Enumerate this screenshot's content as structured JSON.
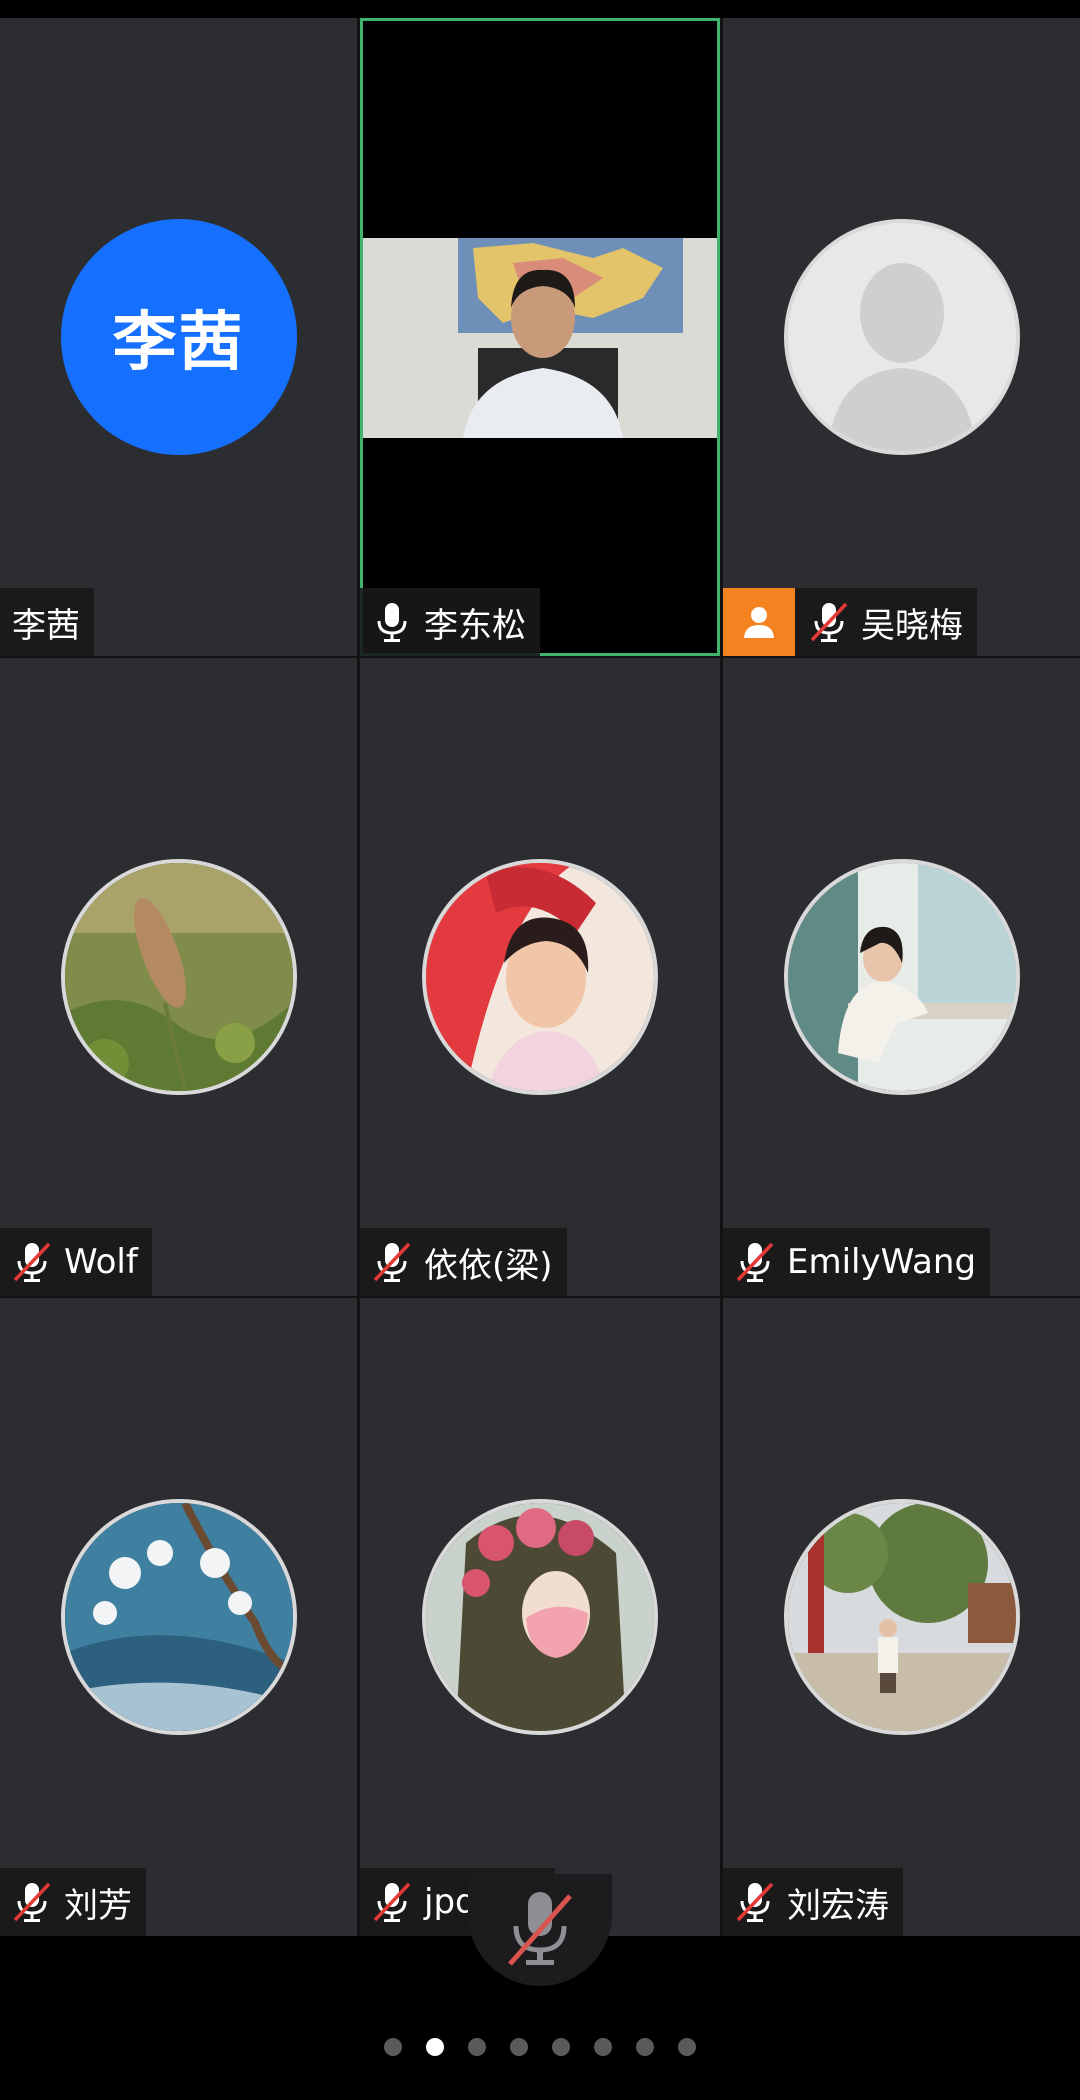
{
  "participants": [
    {
      "name": "李茜",
      "initials": "李茜",
      "avatar": "initials",
      "mic": "none"
    },
    {
      "name": "李东松",
      "avatar": "video",
      "mic": "on",
      "active": true
    },
    {
      "name": "吴晓梅",
      "avatar": "placeholder-person-icon",
      "mic": "muted",
      "host_badge": "person-icon"
    },
    {
      "name": "Wolf",
      "avatar": "photo-grass",
      "mic": "muted"
    },
    {
      "name": "依依(梁)",
      "avatar": "photo-girl-umbrella",
      "mic": "muted"
    },
    {
      "name": "EmilyWang",
      "avatar": "photo-woman-writing",
      "mic": "muted"
    },
    {
      "name": "刘芳",
      "avatar": "photo-blossoms",
      "mic": "muted"
    },
    {
      "name": "jpduan",
      "avatar": "photo-flower-crown",
      "mic": "muted"
    },
    {
      "name": "刘宏涛",
      "avatar": "photo-park",
      "mic": "muted"
    }
  ],
  "controls": {
    "main_mic": "muted-mic-icon"
  },
  "pagination": {
    "count": 8,
    "current": 2
  },
  "colors": {
    "tile_bg": "#2b2d31",
    "active_border": "#3fb36b",
    "initials_avatar": "#1570ff",
    "host_badge": "#f58220",
    "mute_slash": "#e53935"
  }
}
